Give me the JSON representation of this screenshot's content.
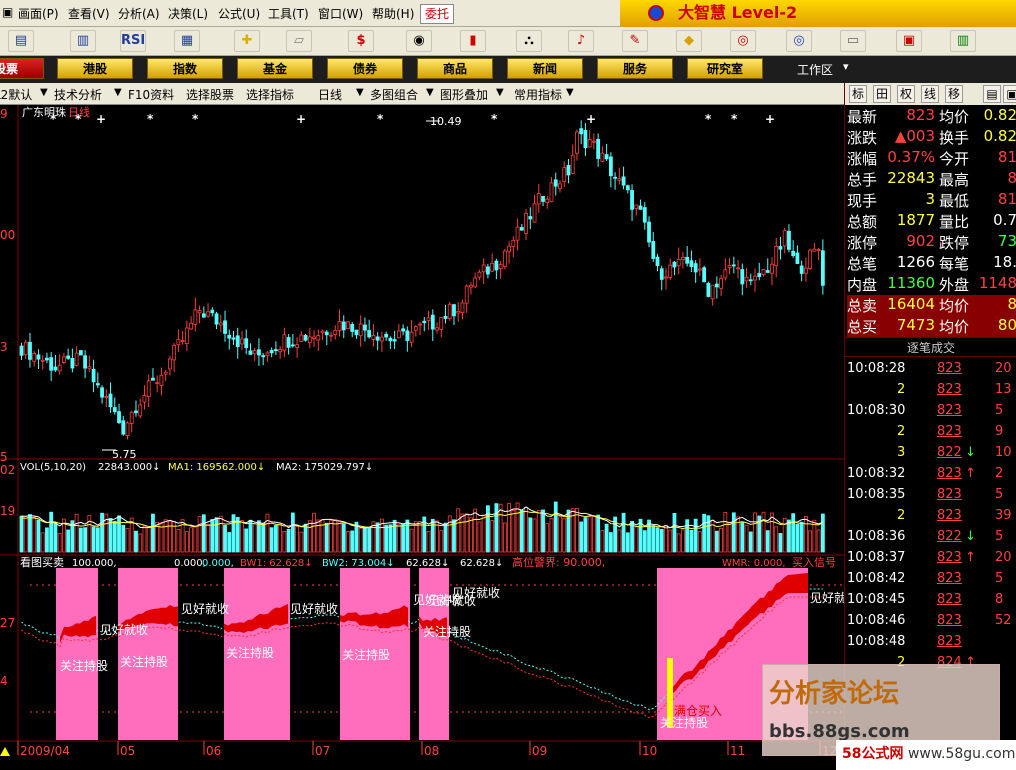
{
  "menu": [
    "画面(P)",
    "查看(V)",
    "分析(A)",
    "决策(L)",
    "公式(U)",
    "工具(T)",
    "窗口(W)",
    "帮助(H)"
  ],
  "menu_trade": "委托",
  "brand": "大智慧 Level-2",
  "toolbar_icons": [
    "chart-icon",
    "chart2-icon",
    "rsi-icon",
    "board-icon",
    "move-icon",
    "ruler-icon",
    "dollar-icon",
    "eye-icon",
    "bars-icon",
    "binoculars-icon",
    "bell-icon",
    "pen-icon",
    "diamond-icon",
    "dollar2-icon",
    "dollar3-icon",
    "print-icon",
    "window-icon",
    "barchart-icon"
  ],
  "toolbar_texts": {
    "rsi": "RSI",
    "dollar": "$"
  },
  "nav": [
    "股票",
    "港股",
    "指数",
    "基金",
    "债券",
    "商品",
    "新闻",
    "服务",
    "研究室"
  ],
  "work_area": "工作区",
  "opts": [
    "L2默认",
    "技术分析",
    "F10资料",
    "选择股票",
    "选择指标",
    "日线",
    "多图组合",
    "图形叠加",
    "常用指标"
  ],
  "rp_tabs": [
    "标",
    "田",
    "权",
    "线",
    "移"
  ],
  "quote": [
    [
      "最新",
      "823",
      "均价",
      "0.82"
    ],
    [
      "涨跌",
      "▲003",
      "换手",
      "0.82"
    ],
    [
      "涨幅",
      "0.37%",
      "今开",
      "81"
    ],
    [
      "总手",
      "22843",
      "最高",
      "8"
    ],
    [
      "现手",
      "3",
      "最低",
      "81"
    ],
    [
      "总额",
      "1877",
      "量比",
      "0.7"
    ],
    [
      "涨停",
      "902",
      "跌停",
      "73"
    ],
    [
      "总笔",
      "1266",
      "每笔",
      "18."
    ],
    [
      "内盘",
      "11360",
      "外盘",
      "1148"
    ],
    [
      "总卖",
      "16404",
      "均价",
      "8"
    ],
    [
      "总买",
      "7473",
      "均价",
      "80"
    ]
  ],
  "tick_title": "逐笔成交",
  "ticks": [
    [
      "10:08:28",
      "823",
      "",
      "20"
    ],
    [
      "2",
      "823",
      "",
      "13"
    ],
    [
      "10:08:30",
      "823",
      "",
      "5"
    ],
    [
      "2",
      "823",
      "",
      "9"
    ],
    [
      "3",
      "822",
      "↓",
      "10"
    ],
    [
      "10:08:32",
      "823",
      "↑",
      "2"
    ],
    [
      "10:08:35",
      "823",
      "",
      "5"
    ],
    [
      "2",
      "823",
      "",
      "39"
    ],
    [
      "10:08:36",
      "822",
      "↓",
      "5"
    ],
    [
      "10:08:37",
      "823",
      "↑",
      "20"
    ],
    [
      "10:08:42",
      "823",
      "",
      "5"
    ],
    [
      "10:08:45",
      "823",
      "",
      "8"
    ],
    [
      "10:08:46",
      "823",
      "",
      "52"
    ],
    [
      "10:08:48",
      "823",
      "",
      ""
    ],
    [
      "2",
      "824",
      "↑",
      ""
    ]
  ],
  "chart": {
    "stock": "广东明珠",
    "period": "日线",
    "max_label": "10.49",
    "min_label": "5.75",
    "ylabels": [
      "9",
      "00",
      "3",
      "5"
    ],
    "vol_header": "VOL(5,10,20)",
    "vol_val": "22843.000↓",
    "ma1": "MA1: 169562.000↓",
    "ma2": "MA2: 175029.797↓",
    "vol_ylabels": [
      "02",
      "19"
    ],
    "ind_header": "看图买卖",
    "ind_vals": [
      "100.000,",
      "0.000,",
      "0.000,",
      "BW1: 62.628↓",
      "BW2: 73.004↓",
      "62.628↓",
      "62.628↓"
    ],
    "ind_warn": "高位警界: 90.000,",
    "wmr": "WMR: 0.000,",
    "buy_sig": "买入信号",
    "ind_ylabels": [
      "27",
      "4"
    ],
    "zone_labels": [
      "关注持股",
      "关注持股",
      "关注持股",
      "关注持股",
      "关注持股",
      "关注持股"
    ],
    "sell_labels": [
      "见好就收",
      "见好就收",
      "见好就收",
      "见好就收",
      "见好就收",
      "见好就收",
      "见好就收"
    ],
    "buy_label": "满仓买入",
    "months": [
      "2009/04",
      "05",
      "06",
      "07",
      "08",
      "09",
      "10",
      "11",
      "12"
    ]
  },
  "watermark": {
    "title": "分析家论坛",
    "url": "bbs.88gs.com",
    "site": "58公式网",
    "site_url": "www.58gu.com"
  },
  "colors": {
    "up": "#ff3c3c",
    "down": "#54ffff",
    "zone": "#ff6ebd"
  }
}
